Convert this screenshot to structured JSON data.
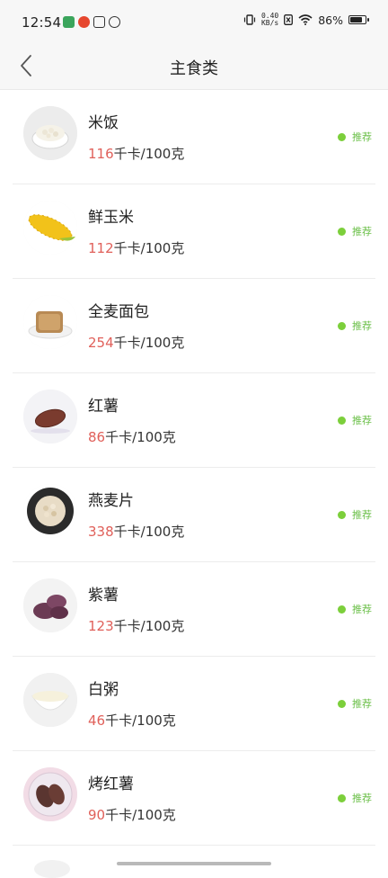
{
  "status_bar": {
    "time": "12:54",
    "net_speed_value": "0.40",
    "net_speed_unit": "KB/s",
    "battery_text": "86%",
    "battery_level": 0.86
  },
  "header": {
    "title": "主食类"
  },
  "foods": [
    {
      "name": "米饭",
      "kcal": "116",
      "unit": "千卡/100克",
      "tag": "推荐",
      "icon": "rice-bowl"
    },
    {
      "name": "鲜玉米",
      "kcal": "112",
      "unit": "千卡/100克",
      "tag": "推荐",
      "icon": "corn"
    },
    {
      "name": "全麦面包",
      "kcal": "254",
      "unit": "千卡/100克",
      "tag": "推荐",
      "icon": "bread"
    },
    {
      "name": "红薯",
      "kcal": "86",
      "unit": "千卡/100克",
      "tag": "推荐",
      "icon": "sweet-potato"
    },
    {
      "name": "燕麦片",
      "kcal": "338",
      "unit": "千卡/100克",
      "tag": "推荐",
      "icon": "oat-flakes"
    },
    {
      "name": "紫薯",
      "kcal": "123",
      "unit": "千卡/100克",
      "tag": "推荐",
      "icon": "purple-potato"
    },
    {
      "name": "白粥",
      "kcal": "46",
      "unit": "千卡/100克",
      "tag": "推荐",
      "icon": "congee-bowl"
    },
    {
      "name": "烤红薯",
      "kcal": "90",
      "unit": "千卡/100克",
      "tag": "推荐",
      "icon": "baked-sweet-potato"
    }
  ],
  "colors": {
    "calorie_number": "#e0605a",
    "tag_text": "#6cc04a",
    "tag_dot": "#7ccf3b"
  }
}
